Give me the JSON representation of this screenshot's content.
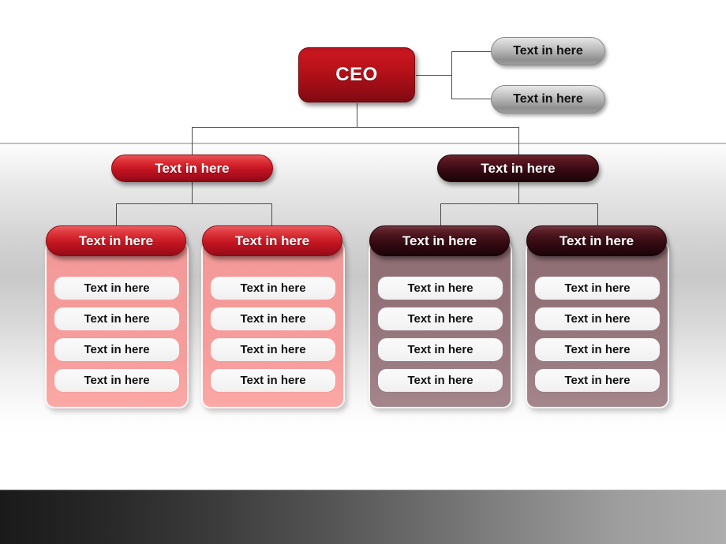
{
  "slide": {
    "type": "organization-chart",
    "background": {
      "mid_band_top_color": "#e9e9e9",
      "mid_band_mid_color": "#c9c9c9",
      "bottom_band_left_color": "#1a1a1a",
      "bottom_band_right_color": "#adadad"
    },
    "colors": {
      "ceo_red": "#b71119",
      "bright_red": "#d3232b",
      "dark_maroon": "#340a12",
      "pink_panel": "#f59d9c",
      "mauve_panel": "#967b81",
      "gray_pill": "#bdbdbd",
      "connector": "#4c4c4c",
      "item_fill": "#f6f6f6"
    }
  },
  "root": {
    "label": "CEO"
  },
  "staff": [
    {
      "label": "Text in here"
    },
    {
      "label": "Text in here"
    }
  ],
  "branches": [
    {
      "label": "Text in here",
      "theme": "red",
      "departments": [
        {
          "header": "Text in here",
          "theme": "pink",
          "items": [
            {
              "label": "Text in here"
            },
            {
              "label": "Text in here"
            },
            {
              "label": "Text in here"
            },
            {
              "label": "Text in here"
            }
          ]
        },
        {
          "header": "Text in here",
          "theme": "pink",
          "items": [
            {
              "label": "Text in here"
            },
            {
              "label": "Text in here"
            },
            {
              "label": "Text in here"
            },
            {
              "label": "Text in here"
            }
          ]
        }
      ]
    },
    {
      "label": "Text in here",
      "theme": "maroon",
      "departments": [
        {
          "header": "Text in here",
          "theme": "mauve",
          "items": [
            {
              "label": "Text in here"
            },
            {
              "label": "Text in here"
            },
            {
              "label": "Text in here"
            },
            {
              "label": "Text in here"
            }
          ]
        },
        {
          "header": "Text in here",
          "theme": "mauve",
          "items": [
            {
              "label": "Text in here"
            },
            {
              "label": "Text in here"
            },
            {
              "label": "Text in here"
            },
            {
              "label": "Text in here"
            }
          ]
        }
      ]
    }
  ]
}
